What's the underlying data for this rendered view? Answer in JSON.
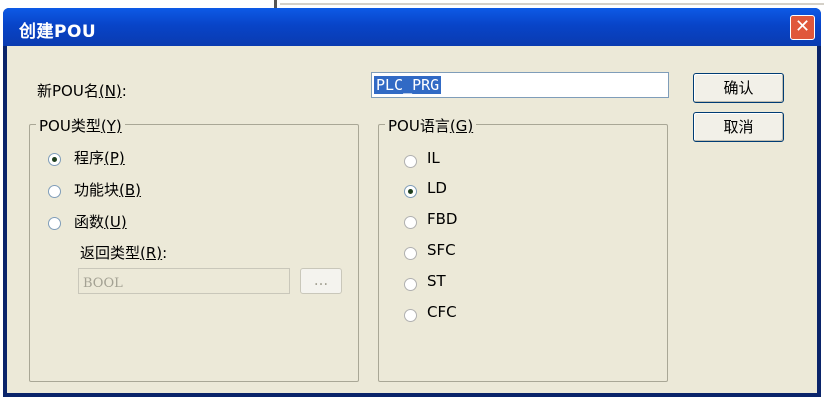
{
  "dialog": {
    "title": "创建POU",
    "close_glyph": "✕"
  },
  "name_field": {
    "label_prefix": "新POU名",
    "label_hotkey": "(N)",
    "label_suffix": ":",
    "value": "PLC_PRG"
  },
  "buttons": {
    "ok": "确认",
    "cancel": "取消"
  },
  "pou_type": {
    "title_prefix": "POU类型",
    "title_hotkey": "(Y)",
    "options": [
      {
        "label": "程序",
        "hotkey": "(P)",
        "selected": true
      },
      {
        "label": "功能块",
        "hotkey": "(B)",
        "selected": false
      },
      {
        "label": "函数",
        "hotkey": "(U)",
        "selected": false
      }
    ],
    "return_type_label": "返回类型",
    "return_type_hotkey": "(R)",
    "return_type_suffix": ":",
    "return_type_value": "BOOL",
    "browse_label": "..."
  },
  "pou_language": {
    "title_prefix": "POU语言",
    "title_hotkey": "(G)",
    "options": [
      {
        "label": "IL",
        "selected": false
      },
      {
        "label": "LD",
        "selected": true
      },
      {
        "label": "FBD",
        "selected": false
      },
      {
        "label": "SFC",
        "selected": false
      },
      {
        "label": "ST",
        "selected": false
      },
      {
        "label": "CFC",
        "selected": false
      }
    ]
  }
}
